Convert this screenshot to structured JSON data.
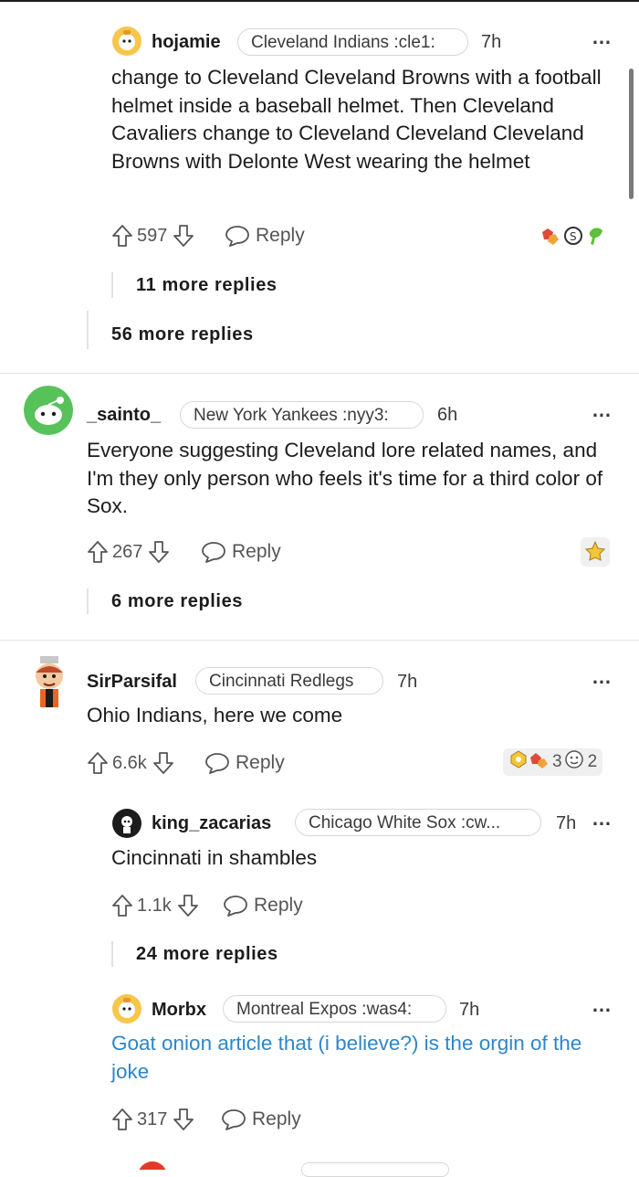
{
  "comments": [
    {
      "username": "hojamie",
      "flair": "Cleveland Indians :cle1:",
      "time": "7h",
      "body": "change to Cleveland Cleveland Browns with a football helmet inside a baseball helmet. Then Cleveland Cavaliers change to Cleveland Cleveland Cleveland Browns with Delonte West wearing the helmet",
      "upvotes": "597",
      "reply_label": "Reply",
      "more_replies": "11 more replies"
    },
    {
      "more_replies": "56 more replies"
    },
    {
      "username": "_sainto_",
      "flair": "New York Yankees :nyy3:",
      "time": "6h",
      "body": "Everyone suggesting Cleveland lore related names, and I'm they only person who feels it's time for a third color of Sox.",
      "upvotes": "267",
      "reply_label": "Reply",
      "more_replies": "6 more replies"
    },
    {
      "username": "SirParsifal",
      "flair": "Cincinnati Redlegs",
      "time": "7h",
      "body": "Ohio Indians, here we come",
      "upvotes": "6.6k",
      "reply_label": "Reply",
      "award_count_1": "3",
      "award_count_2": "2"
    },
    {
      "username": "king_zacarias",
      "flair": "Chicago White Sox :cw...",
      "time": "7h",
      "body": "Cincinnati in shambles",
      "upvotes": "1.1k",
      "reply_label": "Reply",
      "more_replies": "24 more replies"
    },
    {
      "username": "Morbx",
      "flair": "Montreal Expos :was4:",
      "time": "7h",
      "body": "Goat onion article that (i believe?) is the orgin of the joke",
      "upvotes": "317",
      "reply_label": "Reply"
    }
  ],
  "more_icon": "…",
  "icons": [
    "upvote-arrow-icon",
    "downvote-arrow-icon",
    "reply-bubble-icon",
    "overflow-dots-icon",
    "award-icon"
  ],
  "colors": {
    "link": "#2e86c9",
    "text": "#1c1c1c",
    "muted": "#555555"
  }
}
